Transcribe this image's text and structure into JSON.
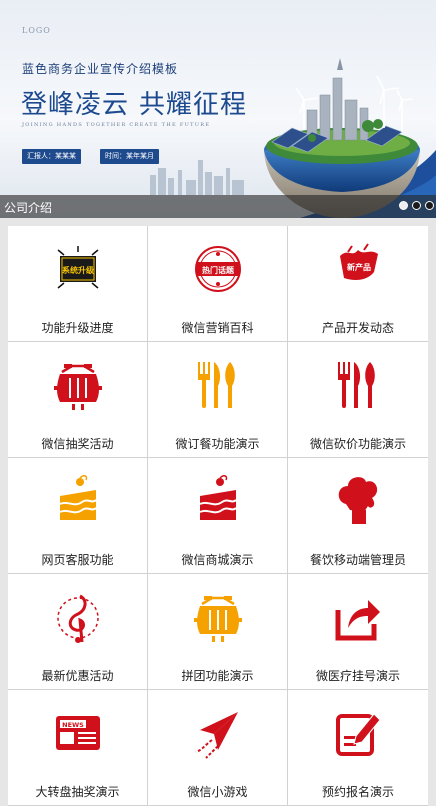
{
  "banner": {
    "logo": "LOGO",
    "subtitle": "蓝色商务企业宣传介绍模板",
    "title_left": "登峰凌云",
    "title_right": "共耀征程",
    "tagline": "JOINING HANDS TOGETHER CREATE THE FUTURE",
    "reporter": "汇报人：某某某",
    "time": "时间：某年某月",
    "caption": "公司介绍",
    "slide_count": 3,
    "active_slide": 1
  },
  "colors": {
    "brand_blue": "#1e4a8e",
    "icon_red": "#d0101a",
    "icon_orange": "#f5a200"
  },
  "features": [
    {
      "label": "功能升级进度",
      "icon": "upgrade-badge-icon",
      "badge_text": "系统升级"
    },
    {
      "label": "微信营销百科",
      "icon": "hot-topic-stamp-icon",
      "badge_text": "热门话题"
    },
    {
      "label": "产品开发动态",
      "icon": "new-product-tag-icon",
      "badge_text": "新产品"
    },
    {
      "label": "微信抽奖活动",
      "icon": "barrel-icon"
    },
    {
      "label": "微订餐功能演示",
      "icon": "cutlery-icon"
    },
    {
      "label": "微信砍价功能演示",
      "icon": "cutlery-icon"
    },
    {
      "label": "网页客服功能",
      "icon": "cake-slice-icon"
    },
    {
      "label": "微信商城演示",
      "icon": "cake-slice-icon"
    },
    {
      "label": "餐饮移动端管理员",
      "icon": "chef-hat-icon"
    },
    {
      "label": "最新优惠活动",
      "icon": "music-note-icon"
    },
    {
      "label": "拼团功能演示",
      "icon": "barrel-icon"
    },
    {
      "label": "微医疗挂号演示",
      "icon": "share-arrow-icon"
    },
    {
      "label": "大转盘抽奖演示",
      "icon": "newspaper-icon",
      "badge_text": "NEWS"
    },
    {
      "label": "微信小游戏",
      "icon": "paper-plane-icon"
    },
    {
      "label": "预约报名演示",
      "icon": "edit-form-icon"
    }
  ]
}
